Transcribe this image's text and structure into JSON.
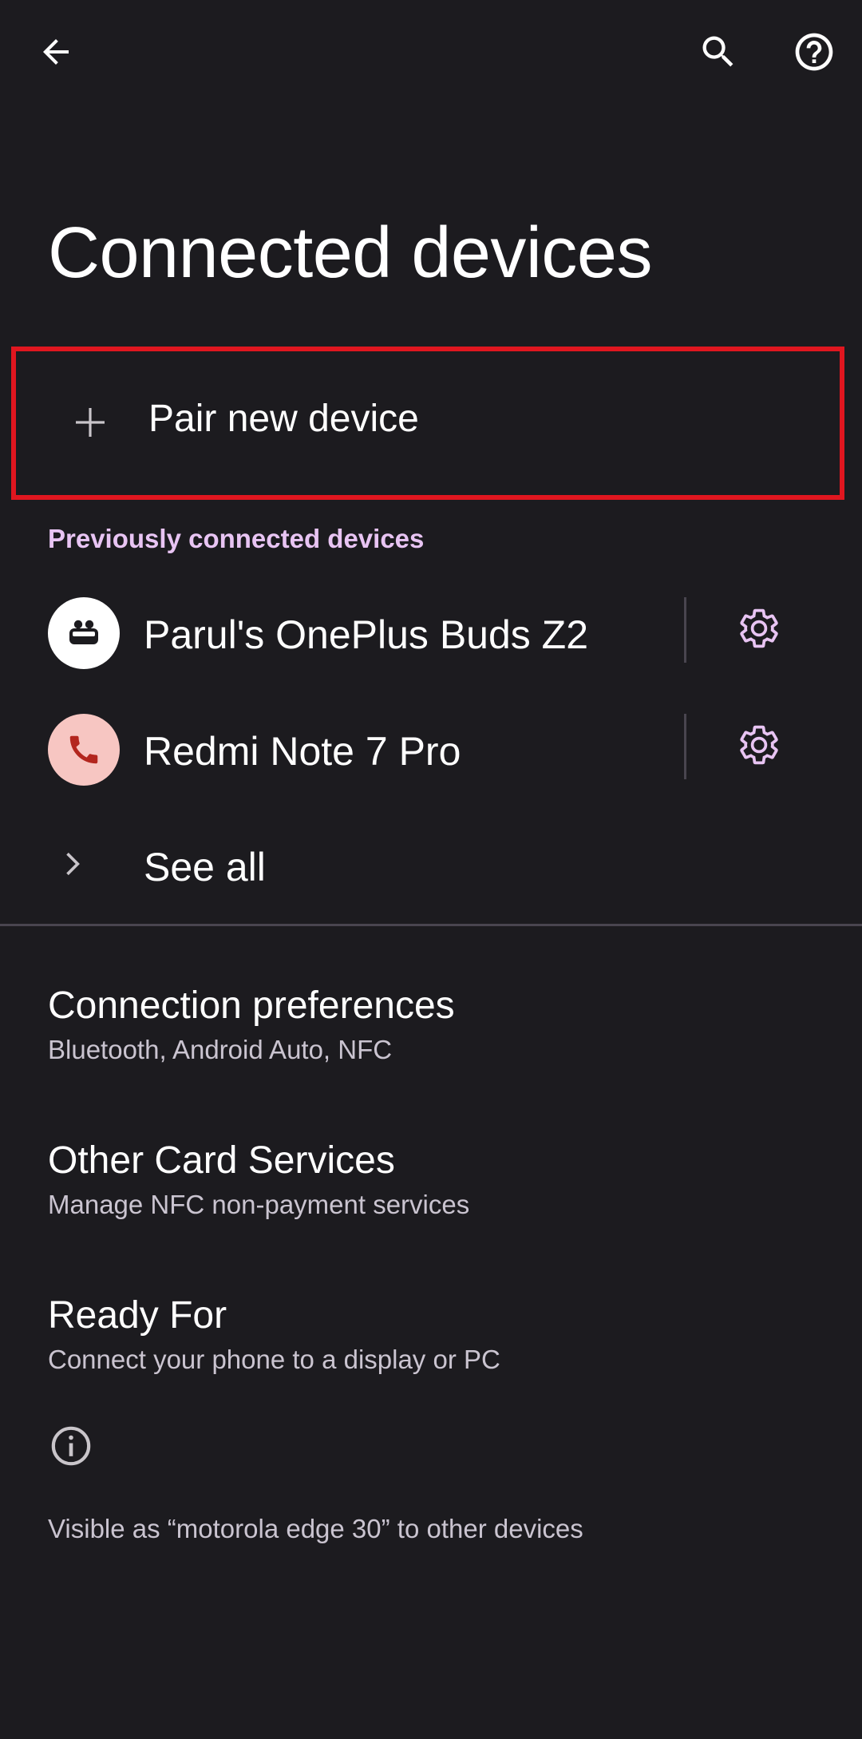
{
  "app_bar": {
    "back_icon": "arrow-back-icon",
    "search_icon": "search-icon",
    "help_icon": "help-icon"
  },
  "page": {
    "title": "Connected devices"
  },
  "pair": {
    "label": "Pair new device",
    "icon": "plus-icon",
    "highlight_color": "#e0161f"
  },
  "previously_connected": {
    "header": "Previously connected devices",
    "accent_color": "#e8c4f3",
    "devices": [
      {
        "name": "Parul's OnePlus Buds Z2",
        "icon": "earbuds-icon",
        "settings_icon": "gear-icon"
      },
      {
        "name": "Redmi Note 7 Pro",
        "icon": "phone-icon",
        "settings_icon": "gear-icon"
      }
    ],
    "see_all": "See all"
  },
  "preferences": [
    {
      "title": "Connection preferences",
      "subtitle": "Bluetooth, Android Auto, NFC"
    },
    {
      "title": "Other Card Services",
      "subtitle": "Manage NFC non-payment services"
    },
    {
      "title": "Ready For",
      "subtitle": "Connect your phone to a display or PC"
    }
  ],
  "footer": {
    "info_icon": "info-icon",
    "visible_as": "Visible as “motorola edge 30” to other devices"
  }
}
